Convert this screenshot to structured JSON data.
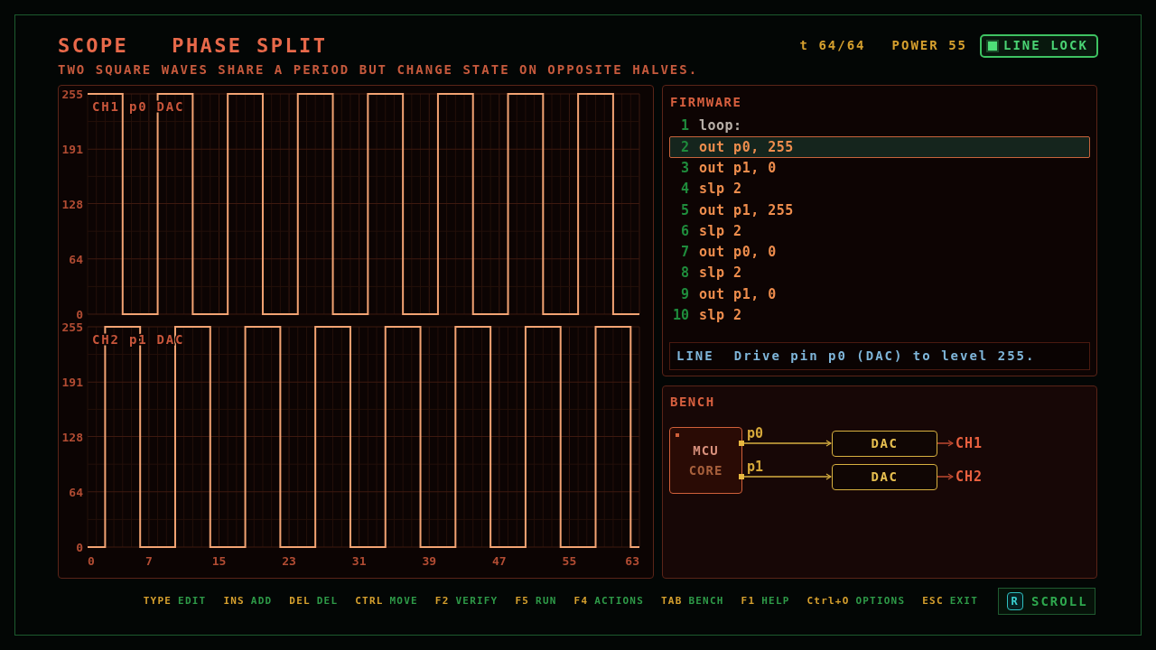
{
  "header": {
    "title": "SCOPE",
    "puzzle": "PHASE SPLIT",
    "description": "TWO SQUARE WAVES SHARE A PERIOD BUT CHANGE STATE ON OPPOSITE HALVES.",
    "tick": "t 64/64",
    "power": "POWER 55",
    "line_lock": {
      "label": "LINE LOCK",
      "on": true
    }
  },
  "scope": {
    "channels": [
      {
        "chart_data": {
          "type": "line",
          "title": "CH1 p0 DAC",
          "x": [
            0,
            4,
            4,
            8,
            8,
            12,
            12,
            16,
            16,
            20,
            20,
            24,
            24,
            28,
            28,
            32,
            32,
            36,
            36,
            40,
            40,
            44,
            44,
            48,
            48,
            52,
            52,
            56,
            56,
            60,
            60,
            63
          ],
          "values": [
            255,
            255,
            0,
            0,
            255,
            255,
            0,
            0,
            255,
            255,
            0,
            0,
            255,
            255,
            0,
            0,
            255,
            255,
            0,
            0,
            255,
            255,
            0,
            0,
            255,
            255,
            0,
            0,
            255,
            255,
            0,
            0
          ],
          "xlim": [
            0,
            63
          ],
          "ylim": [
            0,
            255
          ],
          "yticks": [
            0,
            64,
            128,
            191,
            255
          ],
          "grid": true
        }
      },
      {
        "chart_data": {
          "type": "line",
          "title": "CH2 p1 DAC",
          "x": [
            0,
            2,
            2,
            6,
            6,
            10,
            10,
            14,
            14,
            18,
            18,
            22,
            22,
            26,
            26,
            30,
            30,
            34,
            34,
            38,
            38,
            42,
            42,
            46,
            46,
            50,
            50,
            54,
            54,
            58,
            58,
            62,
            62,
            63
          ],
          "values": [
            0,
            0,
            255,
            255,
            0,
            0,
            255,
            255,
            0,
            0,
            255,
            255,
            0,
            0,
            255,
            255,
            0,
            0,
            255,
            255,
            0,
            0,
            255,
            255,
            0,
            0,
            255,
            255,
            0,
            0,
            255,
            255,
            0,
            0
          ],
          "xlim": [
            0,
            63
          ],
          "ylim": [
            0,
            255
          ],
          "xticks": [
            0,
            7,
            15,
            23,
            31,
            39,
            47,
            55,
            63
          ],
          "yticks": [
            0,
            64,
            128,
            191,
            255
          ],
          "grid": true
        }
      }
    ]
  },
  "firmware": {
    "title": "FIRMWARE",
    "lines": [
      {
        "number": "1",
        "code": "loop:",
        "kind": "label",
        "selected": false
      },
      {
        "number": "2",
        "code": "out p0, 255",
        "kind": "instruction",
        "selected": true
      },
      {
        "number": "3",
        "code": "out p1, 0",
        "kind": "instruction",
        "selected": false
      },
      {
        "number": "4",
        "code": "slp 2",
        "kind": "instruction",
        "selected": false
      },
      {
        "number": "5",
        "code": "out p1, 255",
        "kind": "instruction",
        "selected": false
      },
      {
        "number": "6",
        "code": "slp 2",
        "kind": "instruction",
        "selected": false
      },
      {
        "number": "7",
        "code": "out p0, 0",
        "kind": "instruction",
        "selected": false
      },
      {
        "number": "8",
        "code": "slp 2",
        "kind": "instruction",
        "selected": false
      },
      {
        "number": "9",
        "code": "out p1, 0",
        "kind": "instruction",
        "selected": false
      },
      {
        "number": "10",
        "code": "slp 2",
        "kind": "instruction",
        "selected": false
      }
    ],
    "info": {
      "label": "LINE",
      "text": "Drive pin p0 (DAC) to level 255."
    }
  },
  "bench": {
    "title": "BENCH",
    "mcu": {
      "name": "MCU",
      "subtitle": "CORE"
    },
    "links": [
      {
        "pin": "p0",
        "device": "DAC",
        "output": "CH1"
      },
      {
        "pin": "p1",
        "device": "DAC",
        "output": "CH2"
      }
    ]
  },
  "key_hints": [
    {
      "key": "TYPE",
      "action": "EDIT"
    },
    {
      "key": "INS",
      "action": "ADD"
    },
    {
      "key": "DEL",
      "action": "DEL"
    },
    {
      "key": "CTRL",
      "action": "MOVE"
    },
    {
      "key": "F2",
      "action": "VERIFY"
    },
    {
      "key": "F5",
      "action": "RUN"
    },
    {
      "key": "F4",
      "action": "ACTIONS"
    },
    {
      "key": "TAB",
      "action": "BENCH"
    },
    {
      "key": "F1",
      "action": "HELP"
    },
    {
      "key": "Ctrl+O",
      "action": "OPTIONS"
    },
    {
      "key": "ESC",
      "action": "EXIT"
    }
  ],
  "scroll_button": {
    "key": "R",
    "label": "SCROLL"
  }
}
